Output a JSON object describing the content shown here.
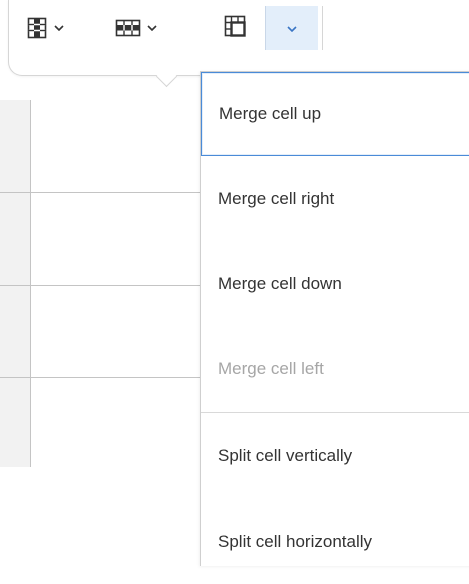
{
  "toolbar": {
    "buttons": [
      {
        "name": "table-column",
        "icon": "table-column-icon"
      },
      {
        "name": "table-row",
        "icon": "table-row-icon"
      },
      {
        "name": "merge-cells",
        "icon": "table-merge-cells-icon"
      }
    ],
    "accent_color": "#3a75c4",
    "active_arrow_bg": "#e3eefa"
  },
  "menu": {
    "items": [
      {
        "label": "Merge cell up",
        "state": "focused"
      },
      {
        "label": "Merge cell right",
        "state": "enabled"
      },
      {
        "label": "Merge cell down",
        "state": "enabled"
      },
      {
        "label": "Merge cell left",
        "state": "disabled"
      },
      {
        "label": "Split cell vertically",
        "state": "enabled"
      },
      {
        "label": "Split cell horizontally",
        "state": "enabled"
      }
    ],
    "focus_color": "#4a8bd8",
    "disabled_color": "#a6a6a6"
  }
}
